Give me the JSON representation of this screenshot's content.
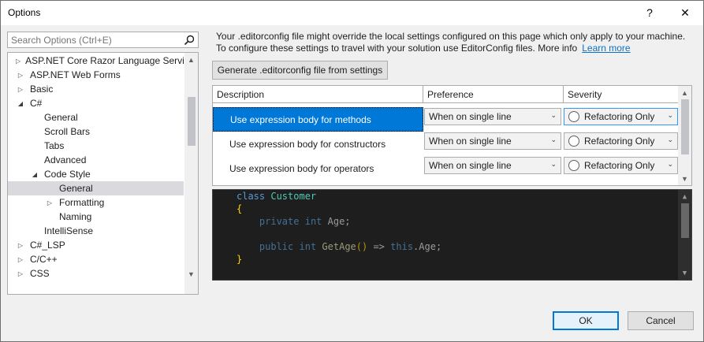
{
  "window": {
    "title": "Options",
    "help_glyph": "?",
    "close_glyph": "✕"
  },
  "search": {
    "placeholder": "Search Options (Ctrl+E)",
    "icon": "search-icon"
  },
  "tree": {
    "items": [
      {
        "label": "ASP.NET Core Razor Language Services",
        "level": 1,
        "expander": "collapsed"
      },
      {
        "label": "ASP.NET Web Forms",
        "level": 1,
        "expander": "collapsed"
      },
      {
        "label": "Basic",
        "level": 1,
        "expander": "collapsed"
      },
      {
        "label": "C#",
        "level": 1,
        "expander": "expanded"
      },
      {
        "label": "General",
        "level": 2,
        "expander": "none"
      },
      {
        "label": "Scroll Bars",
        "level": 2,
        "expander": "none"
      },
      {
        "label": "Tabs",
        "level": 2,
        "expander": "none"
      },
      {
        "label": "Advanced",
        "level": 2,
        "expander": "none"
      },
      {
        "label": "Code Style",
        "level": 2,
        "expander": "expanded"
      },
      {
        "label": "General",
        "level": 3,
        "expander": "none",
        "selected": true
      },
      {
        "label": "Formatting",
        "level": 3,
        "expander": "collapsed"
      },
      {
        "label": "Naming",
        "level": 3,
        "expander": "none"
      },
      {
        "label": "IntelliSense",
        "level": 2,
        "expander": "none"
      },
      {
        "label": "C#_LSP",
        "level": 1,
        "expander": "collapsed"
      },
      {
        "label": "C/C++",
        "level": 1,
        "expander": "collapsed"
      },
      {
        "label": "CSS",
        "level": 1,
        "expander": "collapsed"
      }
    ]
  },
  "info": {
    "text": "Your .editorconfig file might override the local settings configured on this page which only apply to your machine. To configure these settings to travel with your solution use EditorConfig files. More info",
    "link": "Learn more"
  },
  "generate_button": "Generate .editorconfig file from settings",
  "grid": {
    "columns": [
      "Description",
      "Preference",
      "Severity"
    ],
    "rows": [
      {
        "description": "Use expression body for methods",
        "preference": "When on single line",
        "severity": "Refactoring Only",
        "selected": true
      },
      {
        "description": "Use expression body for constructors",
        "preference": "When on single line",
        "severity": "Refactoring Only"
      },
      {
        "description": "Use expression body for operators",
        "preference": "When on single line",
        "severity": "Refactoring Only"
      }
    ]
  },
  "preview": {
    "lines": [
      "class Customer",
      "{",
      "    private int Age;",
      "    public int GetAge() => this.Age;",
      "}"
    ]
  },
  "buttons": {
    "ok": "OK",
    "cancel": "Cancel"
  },
  "colors": {
    "selection": "#0078d7",
    "link": "#0e70c0",
    "code_bg": "#1e1e1e"
  }
}
